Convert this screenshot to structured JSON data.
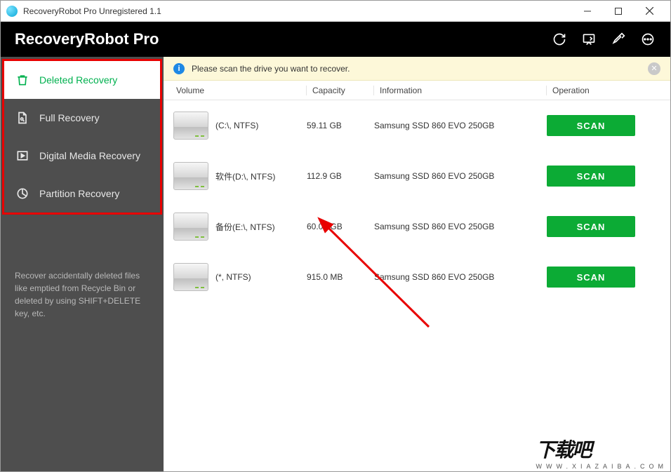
{
  "window": {
    "title": "RecoveryRobot Pro Unregistered 1.1"
  },
  "header": {
    "appname": "RecoveryRobot Pro"
  },
  "sidebar": {
    "items": [
      {
        "label": "Deleted Recovery",
        "active": true
      },
      {
        "label": "Full Recovery",
        "active": false
      },
      {
        "label": "Digital Media Recovery",
        "active": false
      },
      {
        "label": "Partition Recovery",
        "active": false
      }
    ],
    "help": "Recover accidentally deleted files like emptied from Recycle Bin or deleted by using SHIFT+DELETE key, etc."
  },
  "banner": {
    "message": "Please scan the drive you want to recover."
  },
  "columns": {
    "volume": "Volume",
    "capacity": "Capacity",
    "information": "Information",
    "operation": "Operation"
  },
  "scan_label": "SCAN",
  "volumes": [
    {
      "name": "(C:\\, NTFS)",
      "capacity": "59.11 GB",
      "info": "Samsung SSD 860 EVO 250GB"
    },
    {
      "name": "软件(D:\\, NTFS)",
      "capacity": "112.9 GB",
      "info": "Samsung SSD 860 EVO 250GB"
    },
    {
      "name": "备份(E:\\, NTFS)",
      "capacity": "60.00 GB",
      "info": "Samsung SSD 860 EVO 250GB"
    },
    {
      "name": "(*, NTFS)",
      "capacity": "915.0 MB",
      "info": "Samsung SSD 860 EVO 250GB"
    }
  ],
  "watermark": {
    "big": "下载吧",
    "small": "WWW.XIAZAIBA.COM"
  }
}
